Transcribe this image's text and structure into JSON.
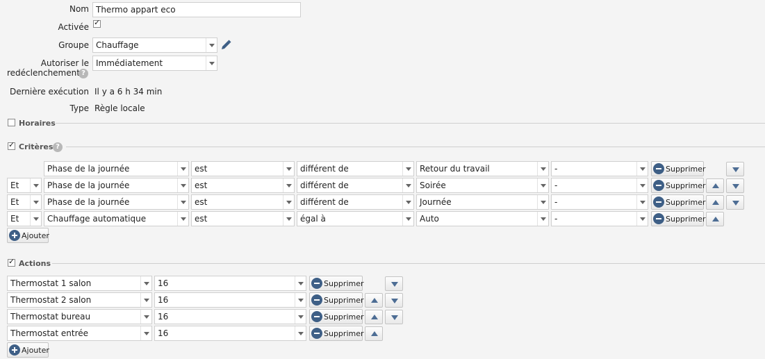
{
  "form": {
    "nom_label": "Nom",
    "nom_value": "Thermo appart eco",
    "activee_label": "Activée",
    "groupe_label": "Groupe",
    "groupe_value": "Chauffage",
    "redecl_label_1": "Autoriser le",
    "redecl_label_2": "redéclenchement",
    "redecl_value": "Immédiatement",
    "derniere_label": "Dernière exécution",
    "derniere_value": "Il y a 6 h 34 min",
    "type_label": "Type",
    "type_value": "Règle locale"
  },
  "sections": {
    "horaires": "Horaires",
    "criteres": "Critères",
    "actions": "Actions"
  },
  "criteria": [
    {
      "conj": "",
      "field": "Phase de la journée",
      "op": "est",
      "cmp": "différent de",
      "value": "Retour du travail",
      "extra": "-",
      "delete": "Supprimer"
    },
    {
      "conj": "Et",
      "field": "Phase de la journée",
      "op": "est",
      "cmp": "différent de",
      "value": "Soirée",
      "extra": "-",
      "delete": "Supprimer"
    },
    {
      "conj": "Et",
      "field": "Phase de la journée",
      "op": "est",
      "cmp": "différent de",
      "value": "Journée",
      "extra": "-",
      "delete": "Supprimer"
    },
    {
      "conj": "Et",
      "field": "Chauffage automatique",
      "op": "est",
      "cmp": "égal à",
      "value": "Auto",
      "extra": "-",
      "delete": "Supprimer"
    }
  ],
  "actions": [
    {
      "target": "Thermostat 1 salon",
      "value": "16",
      "delete": "Supprimer"
    },
    {
      "target": "Thermostat 2 salon",
      "value": "16",
      "delete": "Supprimer"
    },
    {
      "target": "Thermostat bureau",
      "value": "16",
      "delete": "Supprimer"
    },
    {
      "target": "Thermostat entrée",
      "value": "16",
      "delete": "Supprimer"
    }
  ],
  "add_label": "Ajouter",
  "help_glyph": "?",
  "colors": {
    "accent": "#3e5f86",
    "arrow": "#4d6d94",
    "background": "#f4f4f4"
  }
}
